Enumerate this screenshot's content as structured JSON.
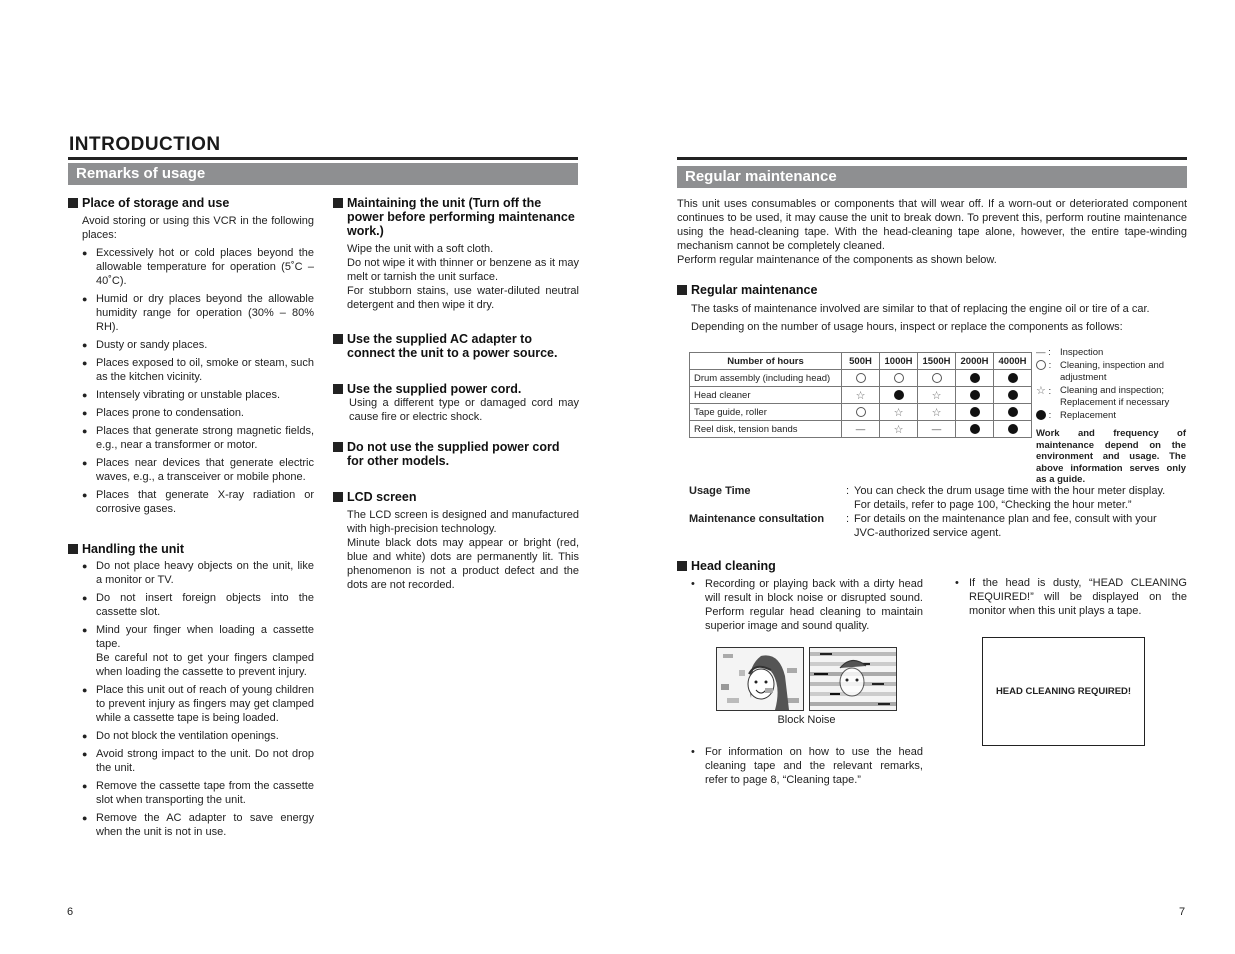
{
  "left_page": {
    "title": "INTRODUCTION",
    "section_band": "Remarks of usage",
    "place_storage": {
      "heading": "Place of storage and use",
      "intro": "Avoid storing or using this VCR in the following places:",
      "items": [
        "Excessively hot or cold places beyond the allowable temperature for operation (5˚C – 40˚C).",
        "Humid or dry places beyond the allowable humidity range for operation (30% – 80% RH).",
        "Dusty or sandy places.",
        "Places exposed to oil, smoke or steam, such as the kitchen vicinity.",
        "Intensely vibrating or unstable places.",
        "Places prone to condensation.",
        "Places that generate strong magnetic fields, e.g., near a transformer or motor.",
        "Places near devices that generate electric waves, e.g., a transceiver or mobile phone.",
        "Places that generate X-ray radiation or corrosive gases."
      ]
    },
    "handling": {
      "heading": "Handling the unit",
      "items": [
        "Do not place heavy objects on the unit, like a monitor or TV.",
        "Do not insert foreign objects into the cassette slot.",
        "Mind your finger when loading a cassette tape.\nBe careful not to get your fingers clamped when loading the cassette to prevent injury.",
        "Place this unit out of reach of young children to prevent injury as fingers may get clamped while a cassette tape is being loaded.",
        "Do not block the ventilation openings.",
        "Avoid strong impact to the unit. Do not drop the unit.",
        "Remove the cassette tape from the cassette slot when transporting the unit.",
        "Remove the AC adapter to save energy when the unit is not in use."
      ]
    },
    "maintaining": {
      "heading": "Maintaining the unit (Turn off the power before performing maintenance work.)",
      "lines": [
        "Wipe the unit with a soft cloth.",
        "Do not wipe it with thinner or benzene as it may melt or tarnish the unit surface.",
        "For stubborn stains, use  water-diluted neutral detergent and then wipe it dry."
      ]
    },
    "ac_adapter": {
      "heading": "Use the supplied AC adapter to connect the unit to a power source."
    },
    "power_cord": {
      "heading": "Use the supplied power cord.",
      "text": "Using a different type or damaged cord may cause fire or electric shock."
    },
    "other_models": {
      "heading": "Do not use the supplied power cord for other models."
    },
    "lcd": {
      "heading": "LCD screen",
      "lines": [
        "The LCD screen is designed and manufactured with high-precision technology.",
        "Minute black dots may appear or bright (red, blue and white) dots are permanently lit. This phenomenon is not a product defect and the dots are not recorded."
      ]
    },
    "page_number": "6"
  },
  "right_page": {
    "section_band": "Regular maintenance",
    "intro_lines": [
      "This unit uses consumables or components that will wear off. If a worn-out or deteriorated component continues to be used, it may cause the unit to break down. To prevent this, perform routine maintenance using the head-cleaning tape. With the head-cleaning tape alone, however, the entire tape-winding mechanism cannot be completely cleaned.",
      "Perform regular maintenance of the components as shown below."
    ],
    "regular": {
      "heading": "Regular maintenance",
      "lines": [
        "The tasks of maintenance involved are similar to that of replacing the engine oil or tire of a car.",
        "Depending on the number of usage hours, inspect or replace the components as follows:"
      ]
    },
    "table": {
      "header": [
        "Number of hours",
        "500H",
        "1000H",
        "1500H",
        "2000H",
        "4000H"
      ],
      "rows": [
        {
          "name": "Drum assembly (including head)",
          "cells": [
            "circle",
            "circle",
            "circle",
            "filled",
            "filled"
          ]
        },
        {
          "name": "Head cleaner",
          "cells": [
            "star",
            "filled",
            "star",
            "filled",
            "filled"
          ]
        },
        {
          "name": "Tape guide, roller",
          "cells": [
            "circle",
            "star",
            "star",
            "filled",
            "filled"
          ]
        },
        {
          "name": "Reel disk, tension bands",
          "cells": [
            "dash",
            "star",
            "dash",
            "filled",
            "filled"
          ]
        }
      ]
    },
    "legend": [
      {
        "symbol": "dash",
        "label": "Inspection"
      },
      {
        "symbol": "circle",
        "label": "Cleaning, inspection and adjustment"
      },
      {
        "symbol": "star",
        "label": "Cleaning and inspection; Replacement if necessary"
      },
      {
        "symbol": "filled",
        "label": "Replacement"
      }
    ],
    "legend_note": "Work and frequency of maintenance depend on the environment and usage. The above information serves only as a guide.",
    "usage_time": {
      "term": "Usage Time",
      "definition": "You can check the drum usage time with the hour meter display. For details, refer to page 100, “Checking the hour meter.”"
    },
    "consultation": {
      "term": "Maintenance consultation",
      "definition": "For details on the maintenance plan and fee, consult with your JVC-authorized service agent."
    },
    "head_cleaning": {
      "heading": "Head cleaning",
      "bullet1": "Recording or playing back with a dirty head will result in block noise or disrupted sound. Perform regular head cleaning to maintain superior image and sound quality.",
      "image_caption": "Block Noise",
      "bullet2": "For information on how to use the head cleaning tape and the relevant remarks, refer to page 8, “Cleaning tape.”",
      "bullet3": "If the head is dusty, “HEAD CLEANING REQUIRED!” will be displayed on the monitor when this unit plays a tape.",
      "monitor_message": "HEAD CLEANING REQUIRED!"
    },
    "page_number": "7"
  }
}
